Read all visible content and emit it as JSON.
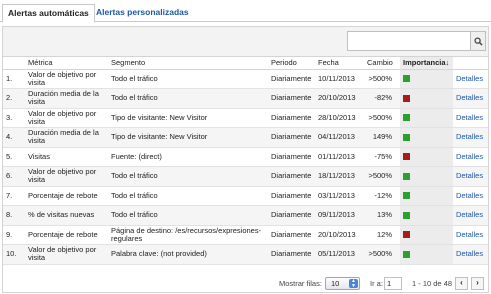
{
  "tabs": [
    {
      "label": "Alertas automáticas",
      "active": true
    },
    {
      "label": "Alertas personalizadas",
      "active": false
    }
  ],
  "search": {
    "placeholder": "",
    "icon": "search-icon"
  },
  "table": {
    "headers": [
      "",
      "Métrica",
      "Segmento",
      "Periodo",
      "Fecha",
      "Cambio",
      "Importancia",
      ""
    ],
    "sort_icon": "arrow-down-icon",
    "colors": {
      "positive": "#2ca02c",
      "negative": "#a61c1c"
    },
    "rows": [
      {
        "index": "1.",
        "metric": "Valor de objetivo por visita",
        "segment": "Todo el tráfico",
        "period": "Diariamente",
        "date": "10/11/2013",
        "change": ">500%",
        "importance": "positive",
        "action": "Detalles"
      },
      {
        "index": "2.",
        "metric": "Duración media de la visita",
        "segment": "Todo el tráfico",
        "period": "Diariamente",
        "date": "20/10/2013",
        "change": "-82%",
        "importance": "negative",
        "action": "Detalles"
      },
      {
        "index": "3.",
        "metric": "Valor de objetivo por visita",
        "segment": "Tipo de visitante: New Visitor",
        "period": "Diariamente",
        "date": "28/10/2013",
        "change": ">500%",
        "importance": "positive",
        "action": "Detalles"
      },
      {
        "index": "4.",
        "metric": "Duración media de la visita",
        "segment": "Tipo de visitante: New Visitor",
        "period": "Diariamente",
        "date": "04/11/2013",
        "change": "149%",
        "importance": "positive",
        "action": "Detalles"
      },
      {
        "index": "5.",
        "metric": "Visitas",
        "segment": "Fuente: (direct)",
        "period": "Diariamente",
        "date": "01/11/2013",
        "change": "-75%",
        "importance": "negative",
        "action": "Detalles"
      },
      {
        "index": "6.",
        "metric": "Valor de objetivo por visita",
        "segment": "Todo el tráfico",
        "period": "Diariamente",
        "date": "18/11/2013",
        "change": ">500%",
        "importance": "positive",
        "action": "Detalles"
      },
      {
        "index": "7.",
        "metric": "Porcentaje de rebote",
        "segment": "Todo el tráfico",
        "period": "Diariamente",
        "date": "03/11/2013",
        "change": "-12%",
        "importance": "positive",
        "action": "Detalles"
      },
      {
        "index": "8.",
        "metric": "% de visitas nuevas",
        "segment": "Todo el tráfico",
        "period": "Diariamente",
        "date": "09/11/2013",
        "change": "13%",
        "importance": "positive",
        "action": "Detalles"
      },
      {
        "index": "9.",
        "metric": "Porcentaje de rebote",
        "segment": "Página de destino: /es/recursos/expresiones-regulares",
        "period": "Diariamente",
        "date": "20/10/2013",
        "change": "12%",
        "importance": "negative",
        "action": "Detalles"
      },
      {
        "index": "10.",
        "metric": "Valor de objetivo por visita",
        "segment": "Palabra clave: (not provided)",
        "period": "Diariamente",
        "date": "05/11/2013",
        "change": ">500%",
        "importance": "positive",
        "action": "Detalles"
      }
    ]
  },
  "footer": {
    "rows_label": "Mostrar filas:",
    "rows_value": "10",
    "goto_label": "Ir a:",
    "goto_value": "1",
    "range": "1 - 10 de 48",
    "prev": "‹",
    "next": "›"
  }
}
